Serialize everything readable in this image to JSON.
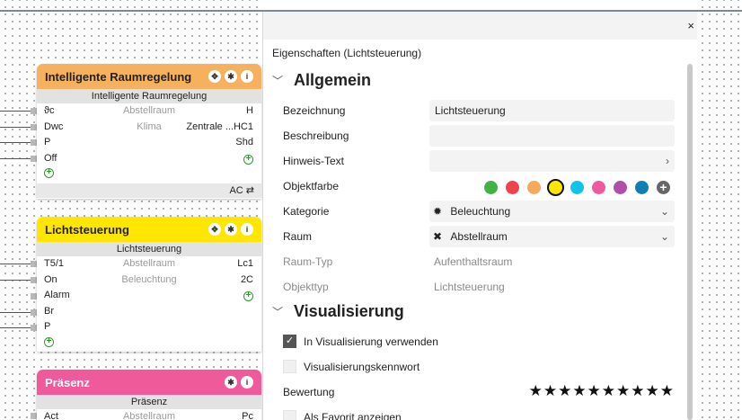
{
  "blocks": {
    "raum": {
      "title": "Intelligente Raumregelung",
      "subtitle": "Intelligente Raumregelung",
      "color": "#f5b15d",
      "rows": [
        {
          "l": "ϑc",
          "m": "Abstellraum",
          "r": "H"
        },
        {
          "l": "Dwc",
          "m": "Klima",
          "r": "Zentrale ...HC1"
        },
        {
          "l": "P",
          "m": "",
          "r": "Shd"
        },
        {
          "l": "Off",
          "m": "",
          "r": ""
        }
      ],
      "footer": "AC ⇄"
    },
    "licht": {
      "title": "Lichtsteuerung",
      "subtitle": "Lichtsteuerung",
      "color": "#ffe600",
      "rows": [
        {
          "l": "T5/1",
          "m": "Abstellraum",
          "r": "Lc1"
        },
        {
          "l": "On",
          "m": "Beleuchtung",
          "r": "2C"
        },
        {
          "l": "Alarm",
          "m": "",
          "r": ""
        },
        {
          "l": "Br",
          "m": "",
          "r": ""
        },
        {
          "l": "P",
          "m": "",
          "r": ""
        }
      ]
    },
    "praesenz": {
      "title": "Präsenz",
      "subtitle": "Präsenz",
      "color": "#ef5a9a",
      "rows": [
        {
          "l": "Act",
          "m": "Abstellraum",
          "r": "Pc"
        }
      ]
    }
  },
  "panel": {
    "title": "Eigenschaften (Lichtsteuerung)",
    "close": "×",
    "sections": {
      "allgemein": "Allgemein",
      "visualisierung": "Visualisierung"
    },
    "labels": {
      "bezeichnung": "Bezeichnung",
      "beschreibung": "Beschreibung",
      "hinweis": "Hinweis-Text",
      "objektfarbe": "Objektfarbe",
      "kategorie": "Kategorie",
      "raum": "Raum",
      "raumtyp": "Raum-Typ",
      "objekttyp": "Objekttyp",
      "bewertung": "Bewertung"
    },
    "values": {
      "bezeichnung": "Lichtsteuerung",
      "beschreibung": "",
      "hinweis": "",
      "kategorie": "Beleuchtung",
      "raum": "Abstellraum",
      "raumtyp": "Aufenthaltsraum",
      "objekttyp": "Lichtsteuerung"
    },
    "colors": [
      "#44b048",
      "#f0434d",
      "#f5a95a",
      "#ffe600",
      "#12c3e8",
      "#ee5a9c",
      "#ae4fa8",
      "#0d7fb5"
    ],
    "selected_color": "#ffe600",
    "checkboxes": {
      "in_vis": {
        "label": "In Visualisierung verwenden",
        "checked": true
      },
      "kennwort": {
        "label": "Visualisierungskennwort",
        "checked": false
      },
      "favorit": {
        "label": "Als Favorit anzeigen",
        "checked": false
      }
    },
    "rating_stars": "★★★★★★★★★★"
  }
}
